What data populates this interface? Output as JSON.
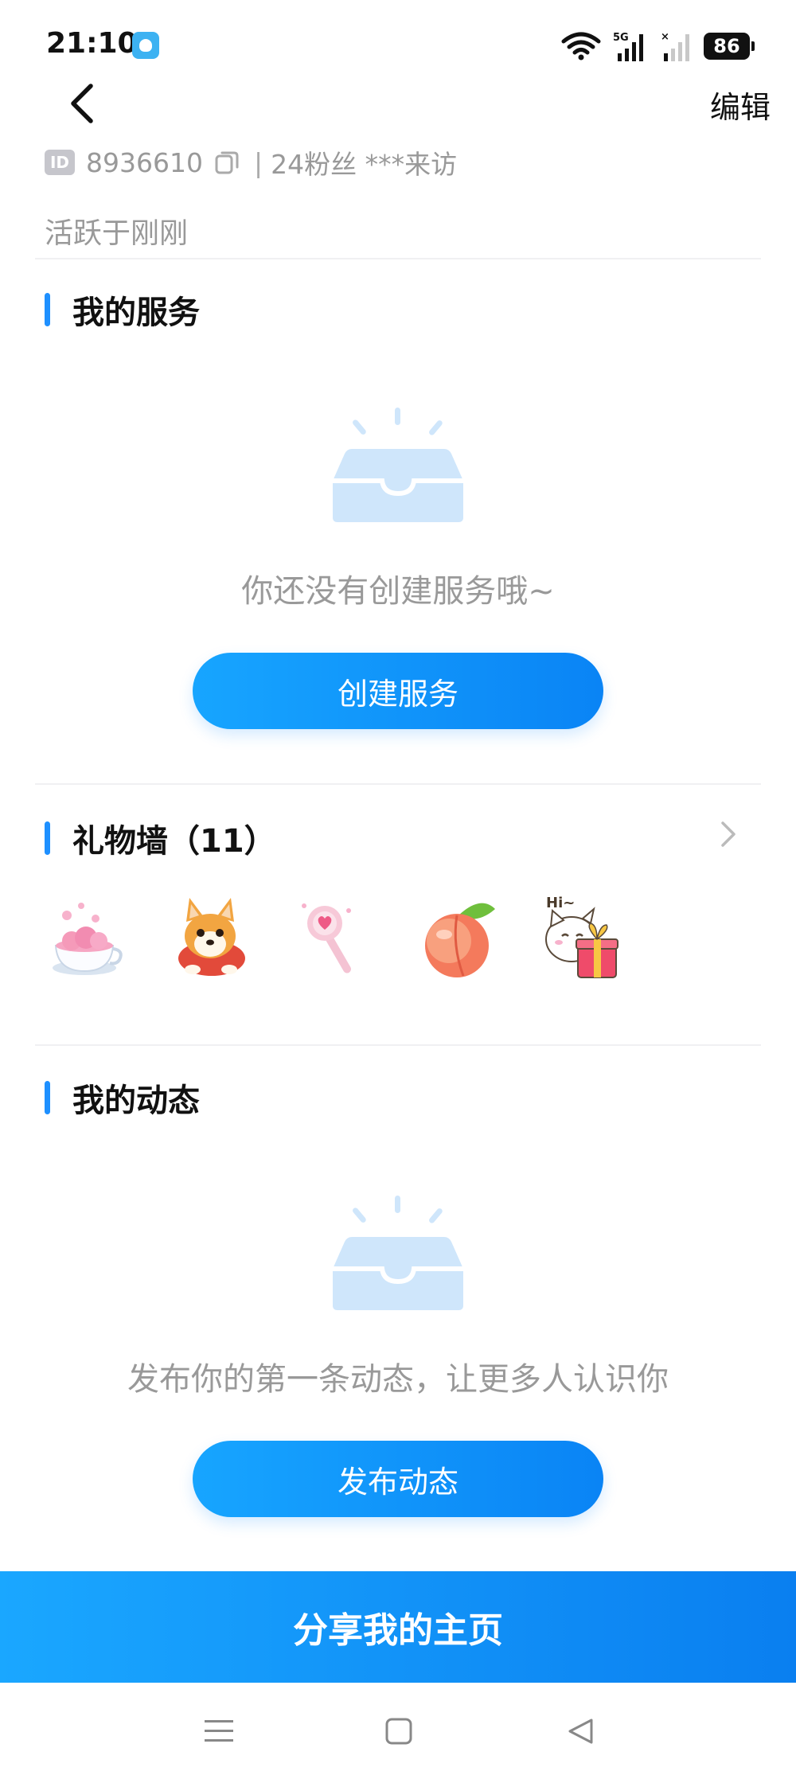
{
  "status_bar": {
    "time": "21:10",
    "signal_label": "5G",
    "battery": "86"
  },
  "nav": {
    "edit_label": "编辑"
  },
  "profile": {
    "id_badge": "ID",
    "id_number": "8936610",
    "separator": "|",
    "fans_visits": "24粉丝 ***来访",
    "active": "活跃于刚刚"
  },
  "services": {
    "title": "我的服务",
    "empty_text": "你还没有创建服务哦~",
    "button_label": "创建服务"
  },
  "gift_wall": {
    "title": "礼物墙（11）",
    "gifts": [
      "teacup-gift",
      "corgi-gift",
      "wand-gift",
      "peach-gift",
      "cat-present-gift"
    ]
  },
  "posts": {
    "title": "我的动态",
    "empty_text": "发布你的第一条动态，让更多人认识你",
    "button_label": "发布动态"
  },
  "share": {
    "label": "分享我的主页"
  },
  "colors": {
    "accent": "#1e90ff",
    "empty_icon": "#cfe6fb",
    "muted_text": "#999999"
  }
}
